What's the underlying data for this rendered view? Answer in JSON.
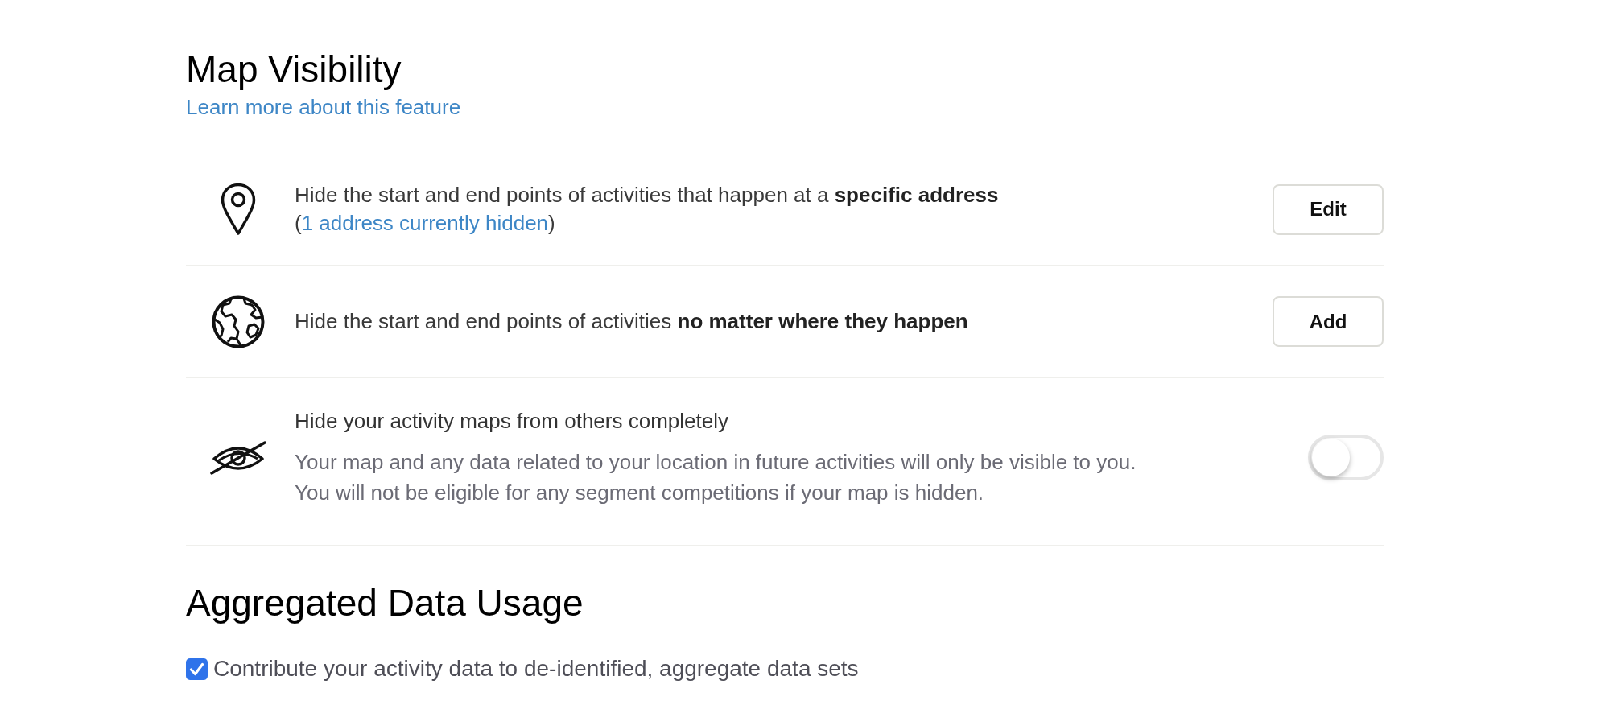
{
  "map_visibility": {
    "title": "Map Visibility",
    "learn_more_link": "Learn more about this feature",
    "options": [
      {
        "kind": "button",
        "text": "Hide the start and end points of activities that happen at a **specific address**",
        "detail": {
          "open": "(",
          "link": "1 address currently hidden",
          "close": ")"
        },
        "button": "Edit"
      },
      {
        "kind": "button",
        "text": "Hide the start and end points of activities **no matter where they happen**",
        "button": "Add"
      },
      {
        "kind": "toggle",
        "title": "Hide your activity maps from others completely",
        "description": [
          "Your map and any data related to your location in future activities will only be visible to you.",
          "You will not be eligible for any segment competitions if your map is hidden."
        ],
        "on": false
      }
    ]
  },
  "aggregated_data_usage": {
    "title": "Aggregated Data Usage",
    "checkbox": {
      "label": "Contribute your activity data to de-identified, aggregate data sets",
      "checked": true
    }
  }
}
